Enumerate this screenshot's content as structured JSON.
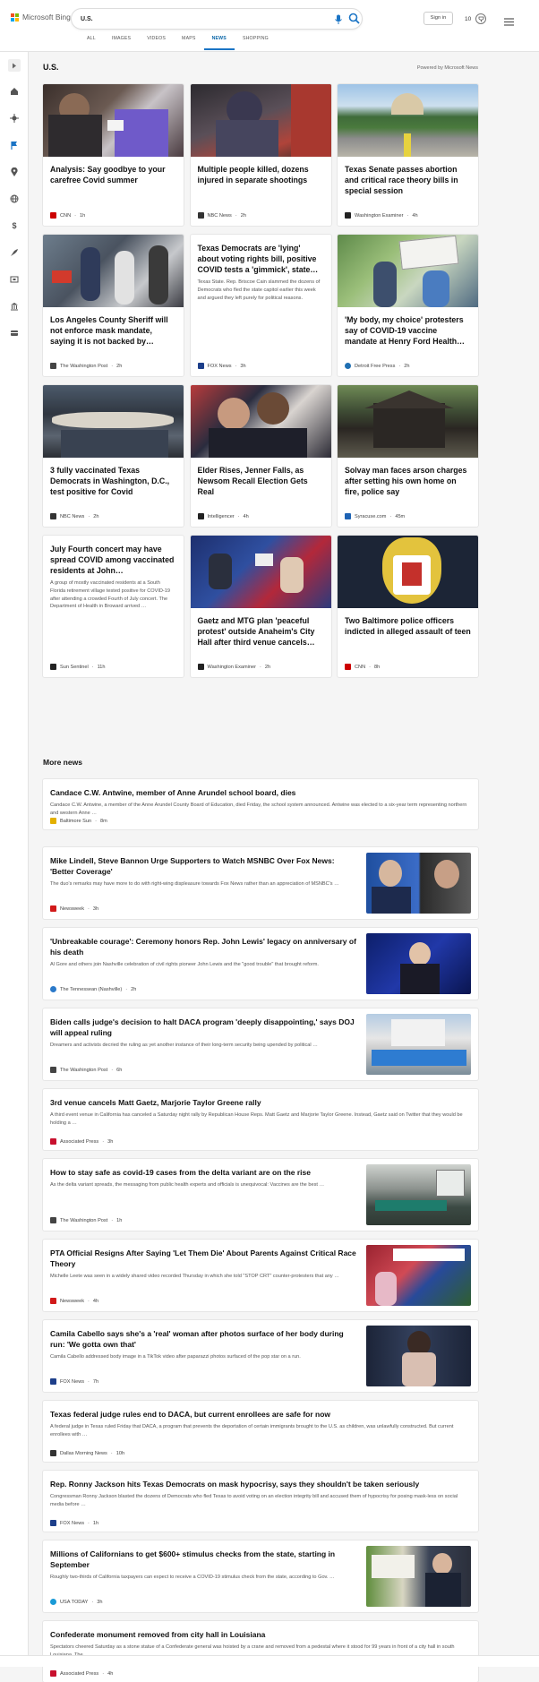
{
  "header": {
    "brand": "Microsoft Bing",
    "search_value": "U.S.",
    "signin_label": "Sign in",
    "rewards_count": "10",
    "tabs": [
      {
        "label": "ALL"
      },
      {
        "label": "IMAGES"
      },
      {
        "label": "VIDEOS"
      },
      {
        "label": "MAPS"
      },
      {
        "label": "NEWS"
      },
      {
        "label": "SHOPPING"
      }
    ],
    "active_tab": "NEWS"
  },
  "section": {
    "title": "U.S.",
    "powered_by": "Powered by Microsoft News"
  },
  "cards": [
    {
      "title": "Analysis: Say goodbye to your carefree Covid summer",
      "source": "CNN",
      "age": "1h",
      "logo_color": "#cc0000"
    },
    {
      "title": "Multiple people killed, dozens injured in separate shootings",
      "source": "NBC News",
      "age": "2h",
      "logo_color": "#333333"
    },
    {
      "title": "Texas Senate passes abortion and critical race theory bills in special session",
      "source": "Washington Examiner",
      "age": "4h",
      "logo_color": "#222222"
    },
    {
      "title": "Los Angeles County Sheriff will not enforce mask mandate, saying it is not backed by…",
      "source": "The Washington Post",
      "age": "2h",
      "logo_color": "#444444"
    },
    {
      "title": "Texas Democrats are 'lying' about voting rights bill, positive COVID tests a 'gimmick', state…",
      "abstract": "Texas State. Rep. Briscoe Cain slammed the dozens of Democrats who fled the state capitol earlier this week and argued they left purely for political reasons.",
      "source": "FOX News",
      "age": "3h",
      "logo_color": "#1d3f8a"
    },
    {
      "title": "'My body, my choice' protesters say of COVID-19 vaccine mandate at Henry Ford Health…",
      "source": "Detroit Free Press",
      "age": "2h",
      "logo_color": "#1f6fb2"
    },
    {
      "title": "3 fully vaccinated Texas Democrats in Washington, D.C., test positive for Covid",
      "source": "NBC News",
      "age": "2h",
      "logo_color": "#333333"
    },
    {
      "title": "Elder Rises, Jenner Falls, as Newsom Recall Election Gets Real",
      "source": "Intelligencer",
      "age": "4h",
      "logo_color": "#222222"
    },
    {
      "title": "Solvay man faces arson charges after setting his own home on fire, police say",
      "source": "Syracuse.com",
      "age": "45m",
      "logo_color": "#1e63b4"
    },
    {
      "title": "July Fourth concert may have spread COVID among vaccinated residents at John…",
      "abstract": "A group of mostly vaccinated residents at a South Florida retirement village tested positive for COVID-19 after attending a crowded Fourth of July concert. The Department of Health in Broward arrived …",
      "source": "Sun Sentinel",
      "age": "11h",
      "logo_color": "#222222"
    },
    {
      "title": "Gaetz and MTG plan 'peaceful protest' outside Anaheim's City Hall after third venue cancels…",
      "source": "Washington Examiner",
      "age": "2h",
      "logo_color": "#222222"
    },
    {
      "title": "Two Baltimore police officers indicted in alleged assault of teen",
      "source": "CNN",
      "age": "8h",
      "logo_color": "#cc0000"
    }
  ],
  "more_news": {
    "title": "More news",
    "items": [
      {
        "title": "Candace C.W. Antwine, member of Anne Arundel school board, dies",
        "snippet": "Candace C.W. Antwine, a member of the Anne Arundel County Board of Education, died Friday, the school system announced. Antwine was elected to a six-year term representing northern and western Anne …",
        "source": "Baltimore Sun",
        "age": "8m",
        "logo_color": "#e3b000",
        "has_thumb": false
      },
      {
        "title": "Mike Lindell, Steve Bannon Urge Supporters to Watch MSNBC Over Fox News: 'Better Coverage'",
        "snippet": "The duo's remarks may have more to do with right-wing displeasure towards Fox News rather than an appreciation of MSNBC's …",
        "source": "Newsweek",
        "age": "3h",
        "logo_color": "#d11a1a",
        "has_thumb": true
      },
      {
        "title": "'Unbreakable courage': Ceremony honors Rep. John Lewis' legacy on anniversary of his death",
        "snippet": "Al Gore and others join Nashville celebration of civil rights pioneer John Lewis and the \"good trouble\" that brought reform.",
        "source": "The Tennessean (Nashville)",
        "age": "2h",
        "logo_color": "#2a79c9",
        "has_thumb": true
      },
      {
        "title": "Biden calls judge's decision to halt DACA program 'deeply disappointing,' says DOJ will appeal ruling",
        "snippet": "Dreamers and activists decried the ruling as yet another instance of their long-term security being upended by political …",
        "source": "The Washington Post",
        "age": "6h",
        "logo_color": "#444444",
        "has_thumb": true
      },
      {
        "title": "3rd venue cancels Matt Gaetz, Marjorie Taylor Greene rally",
        "snippet": "A third event venue in California has canceled a Saturday night rally by Republican House Reps. Matt Gaetz and Marjorie Taylor Greene. Instead, Gaetz said on Twitter that they would be holding a …",
        "source": "Associated Press",
        "age": "3h",
        "logo_color": "#c8102e",
        "has_thumb": false
      },
      {
        "title": "How to stay safe as covid-19 cases from the delta variant are on the rise",
        "snippet": "As the delta variant spreads, the messaging from public health experts and officials is unequivocal: Vaccines are the best …",
        "source": "The Washington Post",
        "age": "1h",
        "logo_color": "#444444",
        "has_thumb": true
      },
      {
        "title": "PTA Official Resigns After Saying 'Let Them Die' About Parents Against Critical Race Theory",
        "snippet": "Michelle Leete was seen in a widely shared video recorded Thursday in which she told \"STOP CRT\" counter-protesters that any …",
        "source": "Newsweek",
        "age": "4h",
        "logo_color": "#d11a1a",
        "has_thumb": true
      },
      {
        "title": "Camila Cabello says she's a 'real' woman after photos surface of her body during run: 'We gotta own that'",
        "snippet": "Camila Cabello addressed body image in a TikTok video after paparazzi photos surfaced of the pop star on a run.",
        "source": "FOX News",
        "age": "7h",
        "logo_color": "#1d3f8a",
        "has_thumb": true
      },
      {
        "title": "Texas federal judge rules end to DACA, but current enrollees are safe for now",
        "snippet": "A federal judge in Texas ruled Friday that DACA, a program that prevents the deportation of certain immigrants brought to the U.S. as children, was unlawfully constructed. But current enrollees with …",
        "source": "Dallas Morning News",
        "age": "10h",
        "logo_color": "#333333",
        "has_thumb": false
      },
      {
        "title": "Rep. Ronny Jackson hits Texas Democrats on mask hypocrisy, says they shouldn't be taken seriously",
        "snippet": "Congressman Ronny Jackson blasted the dozens of Democrats who fled Texas to avoid voting on an election integrity bill and accused them of hypocrisy for posing mask-less on social media before …",
        "source": "FOX News",
        "age": "1h",
        "logo_color": "#1d3f8a",
        "has_thumb": false
      },
      {
        "title": "Millions of Californians to get $600+ stimulus checks from the state, starting in September",
        "snippet": "Roughly two-thirds of California taxpayers can expect to receive a COVID-19 stimulus check from the state, according to Gov. …",
        "source": "USA TODAY",
        "age": "3h",
        "logo_color": "#1a9ad6",
        "has_thumb": true
      },
      {
        "title": "Confederate monument removed from city hall in Louisiana",
        "snippet": "Spectators cheered Saturday as a stone statue of a Confederate general was hoisted by a crane and removed from a pedestal where it stood for 99 years in front of a city hall in south Louisiana. The …",
        "source": "Associated Press",
        "age": "4h",
        "logo_color": "#c8102e",
        "has_thumb": false
      }
    ]
  },
  "icons": [
    "search-icon",
    "mic-icon",
    "trophy-icon",
    "menu-icon",
    "home-icon",
    "flag-icon",
    "globe-icon"
  ]
}
